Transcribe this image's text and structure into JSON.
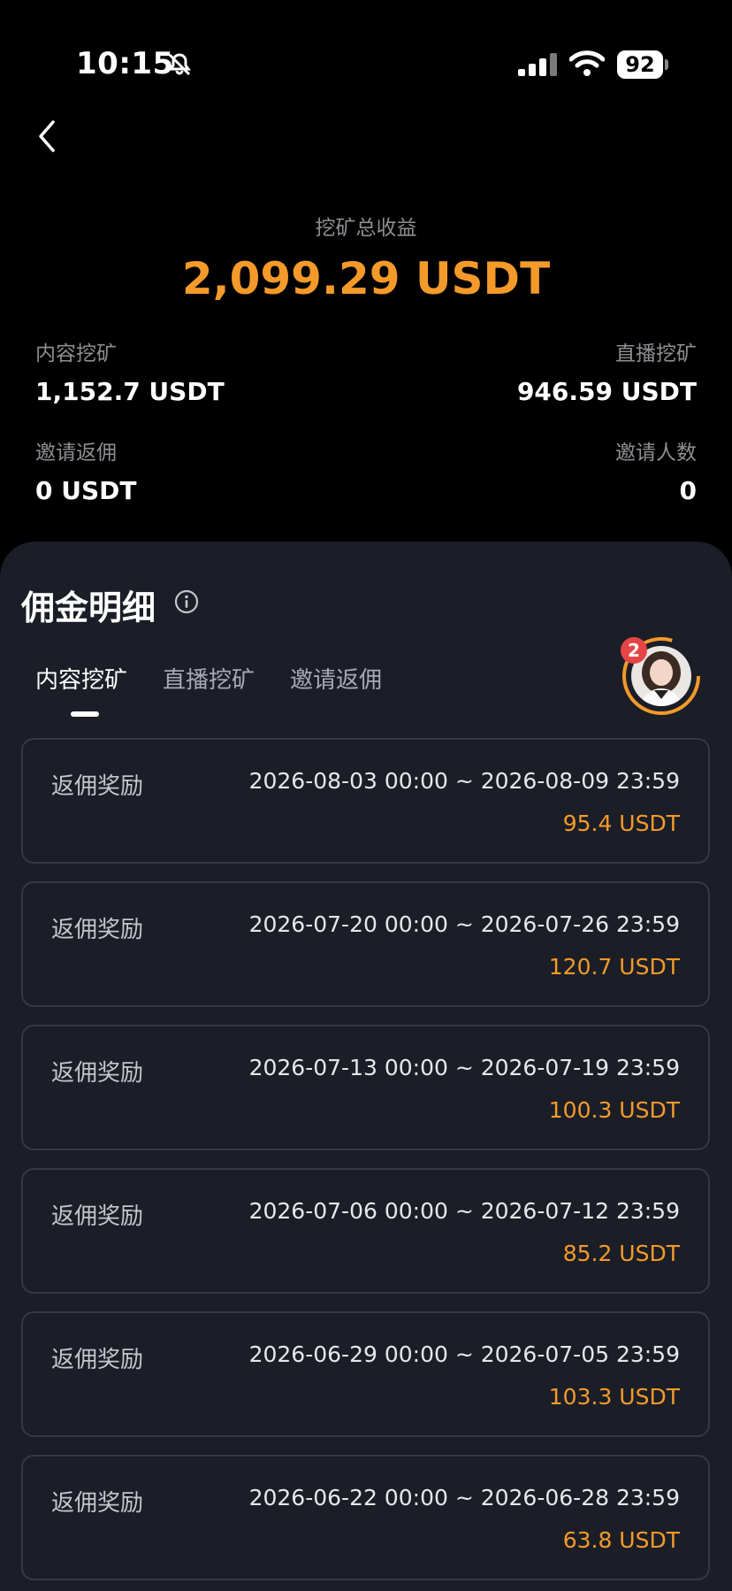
{
  "status_bar": {
    "time": "10:15",
    "battery": "92"
  },
  "summary": {
    "total_label": "挖矿总收益",
    "total_value": "2,099.29 USDT",
    "stats": [
      {
        "label": "内容挖矿",
        "value": "1,152.7 USDT"
      },
      {
        "label": "直播挖矿",
        "value": "946.59 USDT"
      },
      {
        "label": "邀请返佣",
        "value": "0 USDT"
      },
      {
        "label": "邀请人数",
        "value": "0"
      }
    ]
  },
  "details": {
    "title": "佣金明细",
    "tabs": [
      "内容挖矿",
      "直播挖矿",
      "邀请返佣"
    ],
    "active_tab": "内容挖矿",
    "avatar_badge": "2",
    "records": [
      {
        "title": "返佣奖励",
        "range": "2026-08-03 00:00 ~ 2026-08-09 23:59",
        "amount": "95.4 USDT"
      },
      {
        "title": "返佣奖励",
        "range": "2026-07-20 00:00 ~ 2026-07-26 23:59",
        "amount": "120.7 USDT"
      },
      {
        "title": "返佣奖励",
        "range": "2026-07-13 00:00 ~ 2026-07-19 23:59",
        "amount": "100.3 USDT"
      },
      {
        "title": "返佣奖励",
        "range": "2026-07-06 00:00 ~ 2026-07-12 23:59",
        "amount": "85.2 USDT"
      },
      {
        "title": "返佣奖励",
        "range": "2026-06-29 00:00 ~ 2026-07-05 23:59",
        "amount": "103.3 USDT"
      },
      {
        "title": "返佣奖励",
        "range": "2026-06-22 00:00 ~ 2026-06-28 23:59",
        "amount": "63.8 USDT"
      }
    ]
  },
  "colors": {
    "accent": "#f39a2b",
    "panel": "#1b1e27",
    "background": "#000000"
  },
  "icons": [
    "bell-slash-icon",
    "signal-icon",
    "wifi-icon",
    "battery-icon",
    "back-chevron-icon",
    "info-icon"
  ]
}
